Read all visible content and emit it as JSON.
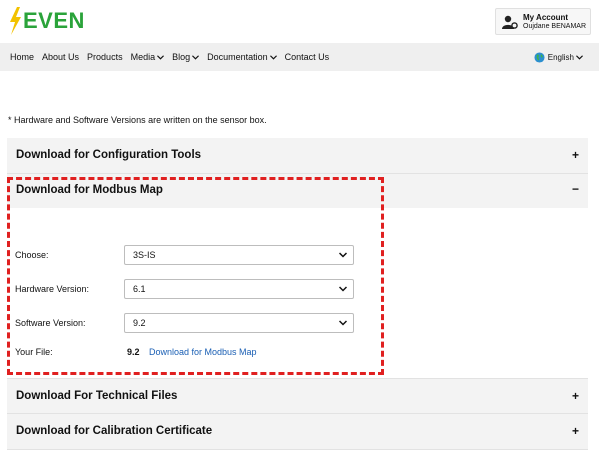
{
  "brand": {
    "logo_text": "EVEN",
    "logo_color": "#2aa33a",
    "bolt_color": "#f2c200"
  },
  "account": {
    "title": "My Account",
    "name": "Oujdane BENAMAR",
    "icon": "user-gear-icon"
  },
  "nav": {
    "items": [
      {
        "label": "Home",
        "dropdown": false
      },
      {
        "label": "About Us",
        "dropdown": false
      },
      {
        "label": "Products",
        "dropdown": false
      },
      {
        "label": "Media",
        "dropdown": true
      },
      {
        "label": "Blog",
        "dropdown": true
      },
      {
        "label": "Documentation",
        "dropdown": true
      },
      {
        "label": "Contact Us",
        "dropdown": false
      }
    ],
    "language": "English"
  },
  "note": "* Hardware and Software Versions are written on the sensor box.",
  "accordions": {
    "config_tools": {
      "title": "Download for Configuration Tools",
      "sign": "+"
    },
    "modbus_map": {
      "title": "Download for Modbus Map",
      "sign": "−"
    },
    "technical_files": {
      "title": "Download For Technical Files",
      "sign": "+"
    },
    "calibration": {
      "title": "Download for Calibration Certificate",
      "sign": "+"
    }
  },
  "form": {
    "choose_label": "Choose:",
    "choose_value": "3S-IS",
    "hardware_label": "Hardware Version:",
    "hardware_value": "6.1",
    "software_label": "Software Version:",
    "software_value": "9.2",
    "file_label": "Your File:",
    "file_value": "9.2",
    "file_link": "Download for Modbus Map"
  },
  "colors": {
    "highlight": "#e02020",
    "link": "#1a5fb4",
    "accordion_bg": "#f3f3f3",
    "nav_bg": "#efefef"
  }
}
